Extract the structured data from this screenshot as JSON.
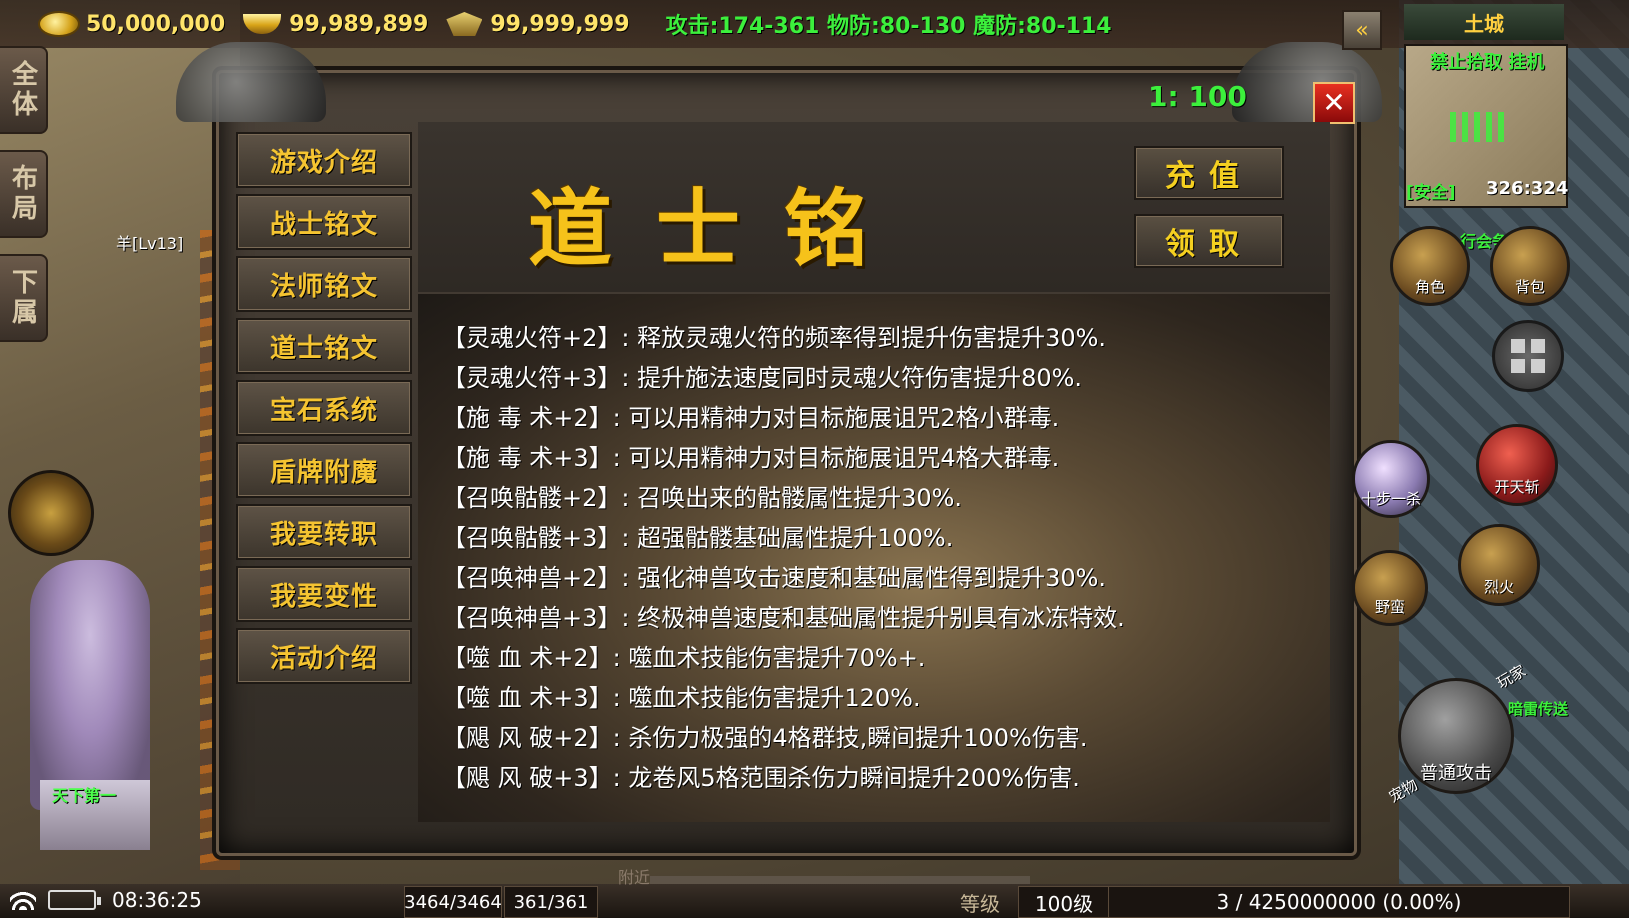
{
  "resources": {
    "gold": "50,000,000",
    "ingot": "99,989,899",
    "emblem": "99,999,999"
  },
  "stats": "攻击:174-361 物防:80-130 魔防:80-114",
  "side_tabs": [
    "全体",
    "布局",
    "下属"
  ],
  "scene": {
    "character_label": "羊[Lv13]",
    "statue_label": "天下第一"
  },
  "panel": {
    "ratio": "1: 100",
    "close_glyph": "✕",
    "title": "道士铭文",
    "recharge_label": "充值",
    "claim_label": "领取",
    "menu": [
      "游戏介绍",
      "战士铭文",
      "法师铭文",
      "道士铭文",
      "宝石系统",
      "盾牌附魔",
      "我要转职",
      "我要变性",
      "活动介绍"
    ],
    "descriptions": [
      "【灵魂火符+2】: 释放灵魂火符的频率得到提升伤害提升30%.",
      "【灵魂火符+3】: 提升施法速度同时灵魂火符伤害提升80%.",
      "【施 毒 术+2】: 可以用精神力对目标施展诅咒2格小群毒.",
      "【施 毒 术+3】: 可以用精神力对目标施展诅咒4格大群毒.",
      "【召唤骷髅+2】: 召唤出来的骷髅属性提升30%.",
      "【召唤骷髅+3】: 超强骷髅基础属性提升100%.",
      "【召唤神兽+2】: 强化神兽攻击速度和基础属性得到提升30%.",
      "【召唤神兽+3】: 终极神兽速度和基础属性提升别具有冰冻特效.",
      "【噬 血 术+2】: 噬血术技能伤害提升70%+.",
      "【噬 血 术+3】: 噬血术技能伤害提升120%.",
      "【飓 风 破+2】: 杀伤力极强的4格群技,瞬间提升100%伤害.",
      "【飓 风 破+3】: 龙卷风5格范围杀伤力瞬间提升200%伤害."
    ]
  },
  "hud": {
    "collapse_glyph": "«",
    "map_name": "土城",
    "minimap_label": "禁止拾取 挂机",
    "safe_label": "[安全]",
    "coordinates": "326:324",
    "guild_label": "行会争",
    "buttons": {
      "character": "角色",
      "bag": "背包",
      "skill_ten_steps": "十步一杀",
      "skill_sky_slash": "开天斩",
      "skill_savage": "野蛮",
      "skill_fire": "烈火",
      "attack": "普通攻击",
      "player": "玩家",
      "pet": "宠物",
      "teleport": "暗雷传送"
    }
  },
  "bottom": {
    "time": "08:36:25",
    "hp": "3464/3464",
    "mp": "361/361",
    "chat_tab": "附近",
    "level_label": "等级",
    "level": "100级",
    "exp": "3 / 4250000000 (0.00%)"
  },
  "colors": {
    "title_gold": "#f6c21a",
    "menu_text": "#f5c431",
    "stat_green": "#3cf03c",
    "close_red": "#e83020"
  }
}
